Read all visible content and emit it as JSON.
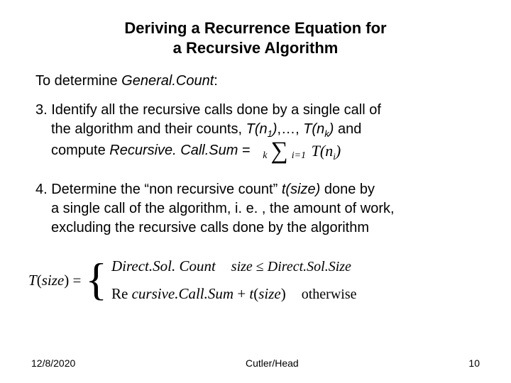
{
  "title_line1": "Deriving a Recurrence Equation for",
  "title_line2": "a Recursive Algorithm",
  "intro_prefix": "To determine ",
  "intro_term": "General.Count",
  "intro_suffix": ":",
  "item3": {
    "lead": "3. Identify all the recursive calls done by a single call of",
    "line2a": "the algorithm and their counts, ",
    "T": "T",
    "lpar": "(",
    "rpar": ")",
    "n": "n",
    "one": "1",
    "k": "k",
    "sep": ",…, ",
    "line2b": " and",
    "line3a": "compute  ",
    "rcs": "Recursive. Call.Sum",
    "eq": " = ",
    "sum_top": "k",
    "sum_bot": "i=1",
    "sum_term_T": "T",
    "sum_term_n": "n",
    "sum_term_i": "i"
  },
  "item4": {
    "lead": "4. Determine the “non recursive count”  ",
    "t": "t",
    "size": "size",
    "after_t": " done by",
    "line2": "a single call of the algorithm, i. e. , the amount of work,",
    "line3": "excluding the recursive calls done by the algorithm"
  },
  "eq": {
    "T": "T",
    "size": "size",
    "eq": " = ",
    "case1_expr": "Direct.Sol. Count",
    "case1_cond_lhs": "size",
    "case1_cond_op": " ≤ ",
    "case1_cond_rhs": "Direct.Sol.Size",
    "case2_re": "Re ",
    "case2_rest": "cursive.Call.Sum",
    "plus": " + ",
    "t": "t",
    "case2_cond": "otherwise"
  },
  "footer": {
    "date": "12/8/2020",
    "author": "Cutler/Head",
    "page": "10"
  }
}
